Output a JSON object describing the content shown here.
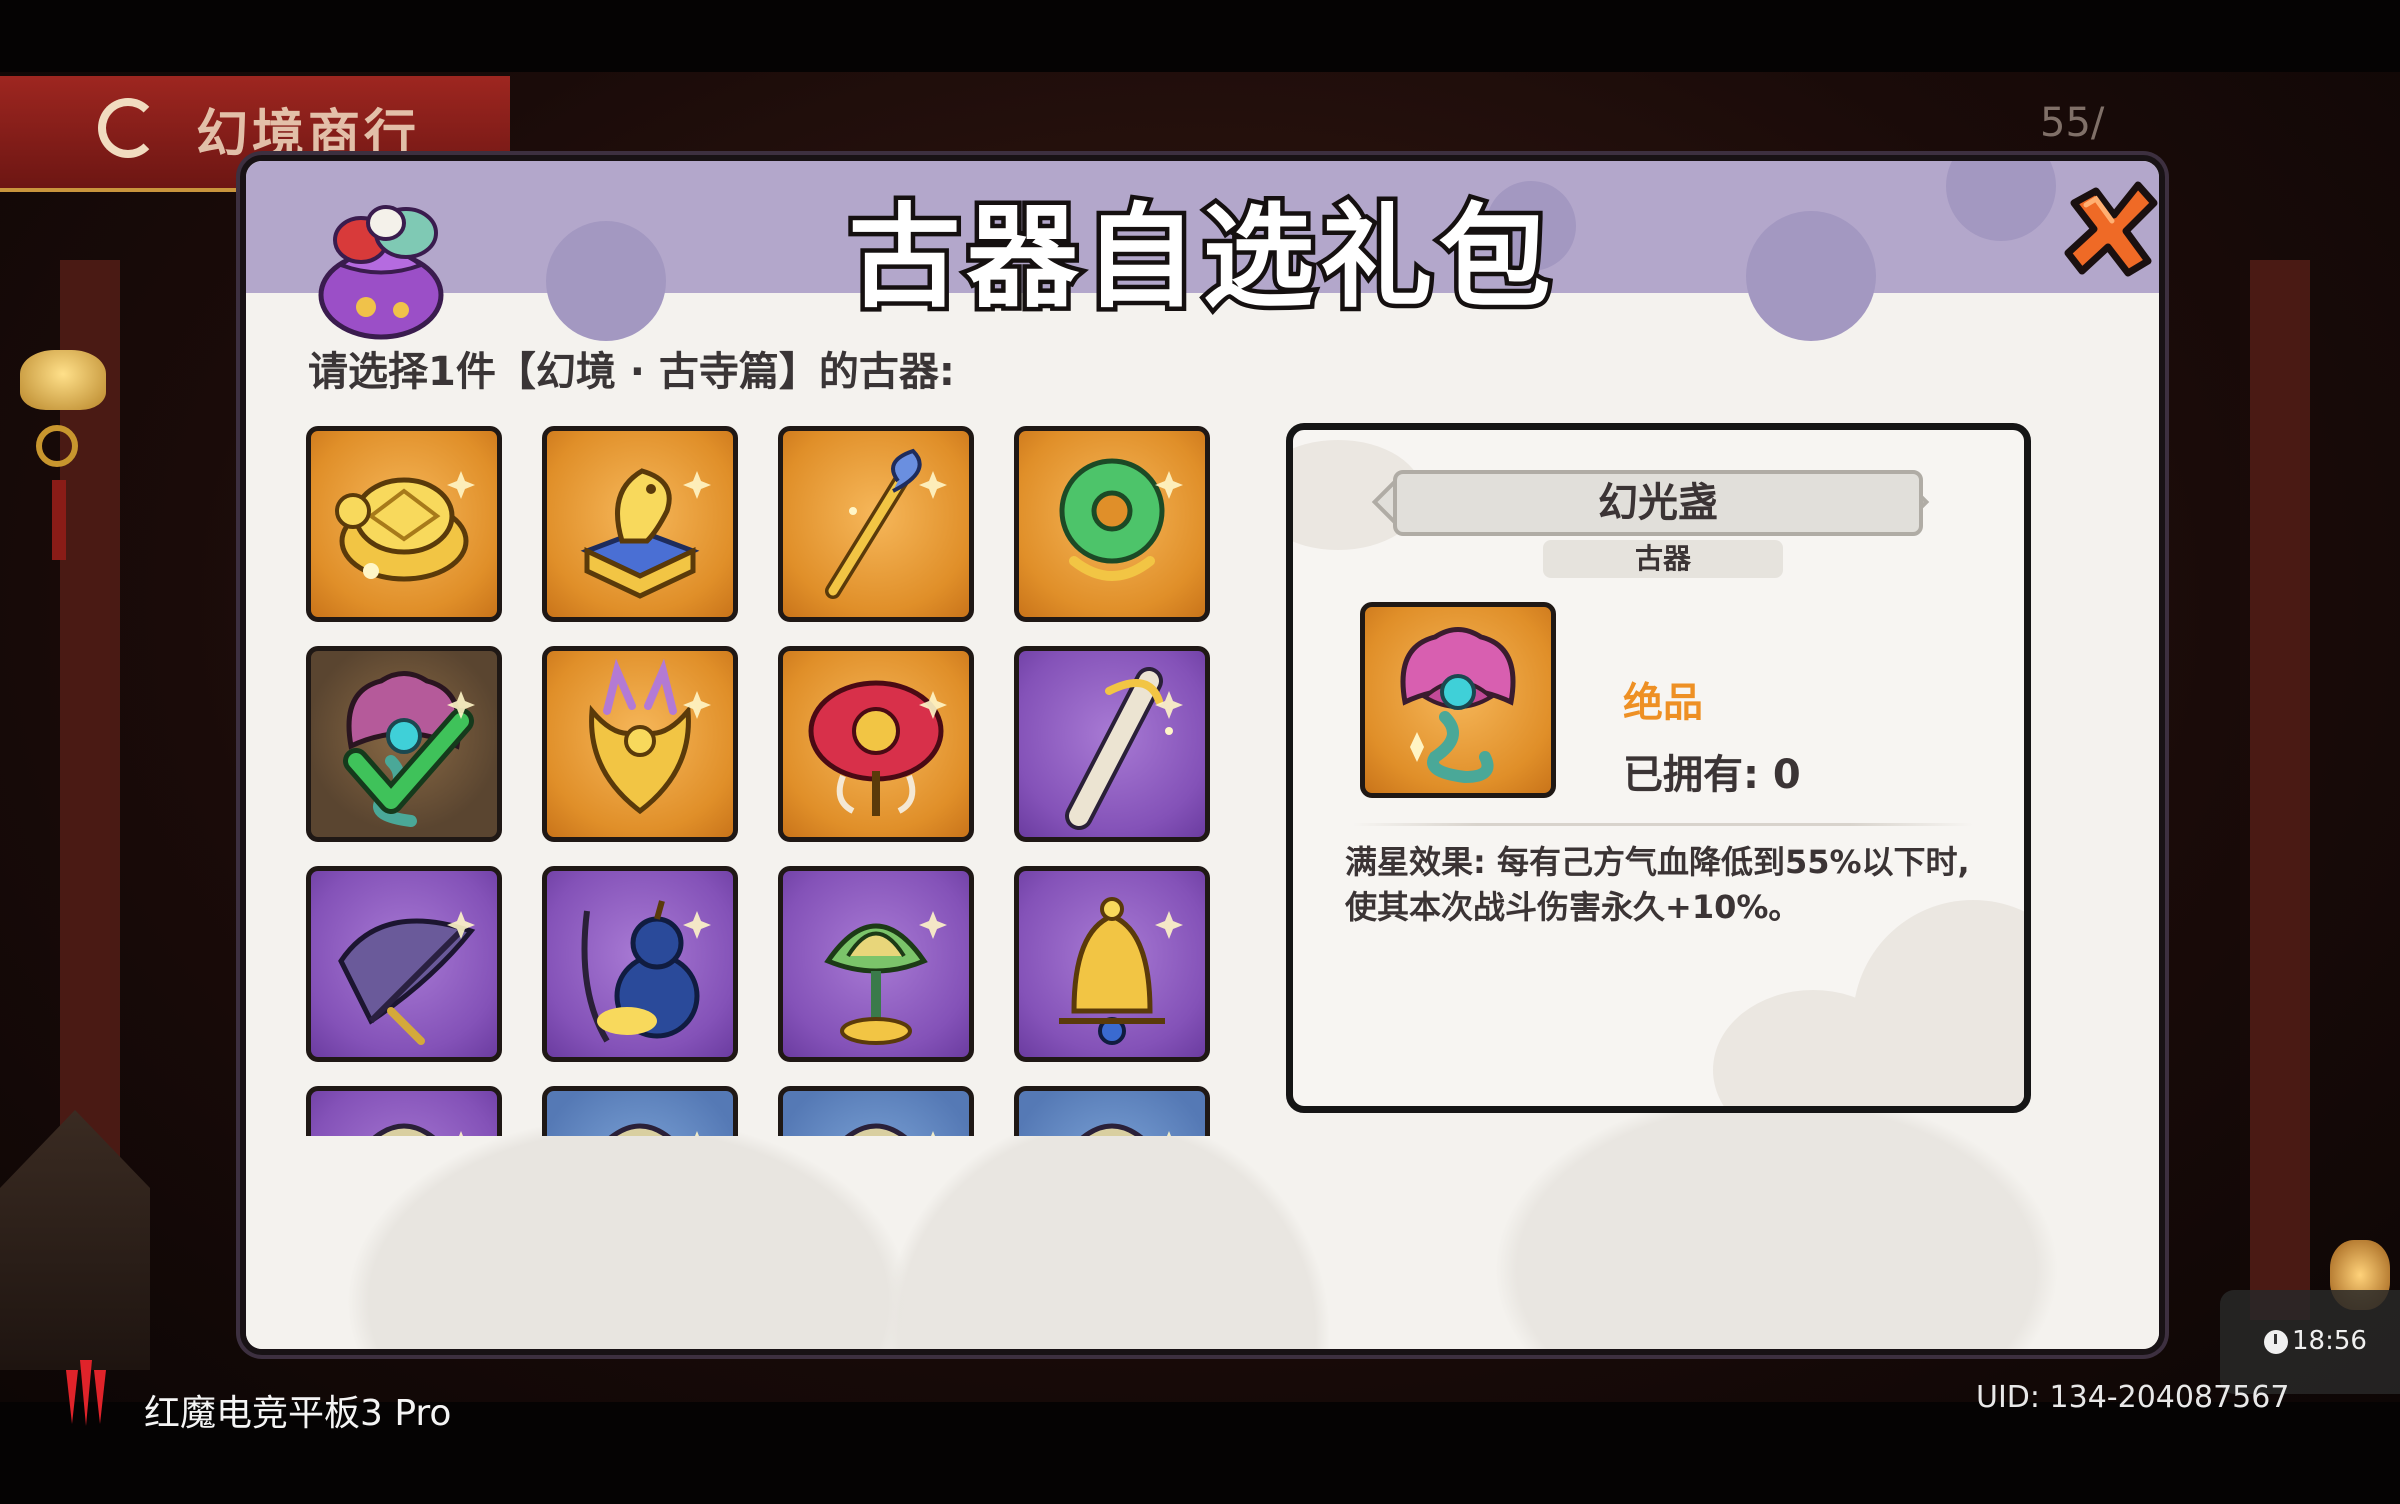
{
  "background": {
    "title": "幻境商行",
    "counter": "55/"
  },
  "dialog": {
    "title": "古器自选礼包",
    "prompt": "请选择1件【幻境 · 古寺篇】的古器:",
    "items": [
      {
        "icon": "golden-turtle-icon",
        "frame": "gold"
      },
      {
        "icon": "golden-dragon-seal-icon",
        "frame": "gold"
      },
      {
        "icon": "dragon-staff-icon",
        "frame": "gold"
      },
      {
        "icon": "jade-ring-icon",
        "frame": "gold"
      },
      {
        "icon": "pearl-shell-icon",
        "frame": "selected",
        "selected": true
      },
      {
        "icon": "golden-phoenix-icon",
        "frame": "gold"
      },
      {
        "icon": "red-umbrella-icon",
        "frame": "gold"
      },
      {
        "icon": "scroll-sword-icon",
        "frame": "purple"
      },
      {
        "icon": "feather-fan-icon",
        "frame": "purple"
      },
      {
        "icon": "gourd-icon",
        "frame": "purple"
      },
      {
        "icon": "lotus-lamp-icon",
        "frame": "purple"
      },
      {
        "icon": "golden-bell-icon",
        "frame": "purple"
      },
      {
        "icon": "artifact-icon",
        "frame": "purple"
      },
      {
        "icon": "artifact-icon",
        "frame": "blue"
      },
      {
        "icon": "artifact-icon",
        "frame": "blue"
      },
      {
        "icon": "artifact-icon",
        "frame": "blue"
      }
    ],
    "detail": {
      "name": "幻光盏",
      "type": "古器",
      "icon": "pearl-shell-icon",
      "rarity": "绝品",
      "owned": "已拥有: 0",
      "effect": "满星效果: 每有己方气血降低到55%以下时, 使其本次战斗伤害永久+10%。"
    }
  },
  "device": {
    "clock": "18:56",
    "name": "红魔电竞平板3 Pro",
    "uid": "UID: 134-204087567"
  },
  "colors": {
    "header": "#b3a7cb",
    "gold_frame": "#e08f29",
    "purple_frame": "#8452b8",
    "rarity": "#ee9024"
  }
}
